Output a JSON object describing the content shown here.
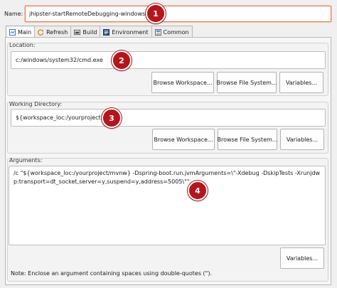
{
  "name": {
    "label": "Name:",
    "value": "jhipster-startRemoteDebugging-windows"
  },
  "tabs": [
    {
      "label": "Main",
      "icon": "main-tab-icon",
      "active": true
    },
    {
      "label": "Refresh",
      "icon": "refresh-icon",
      "active": false
    },
    {
      "label": "Build",
      "icon": "build-icon",
      "active": false
    },
    {
      "label": "Environment",
      "icon": "environment-icon",
      "active": false
    },
    {
      "label": "Common",
      "icon": "common-icon",
      "active": false
    }
  ],
  "location": {
    "label": "Location:",
    "value": "c:/windows/system32/cmd.exe",
    "browse_workspace": "Browse Workspace...",
    "browse_file_system": "Browse File System...",
    "variables": "Variables..."
  },
  "working_directory": {
    "label": "Working Directory:",
    "value": "${workspace_loc:/yourproject}",
    "browse_workspace": "Browse Workspace...",
    "browse_file_system": "Browse File System...",
    "variables": "Variables..."
  },
  "arguments": {
    "label": "Arguments:",
    "value": "/c \"${workspace_loc:/yourproject/mvnw} -Dspring-boot.run.jvmArguments=\\\"-Xdebug -DskipTests -Xrunjdwp:transport=dt_socket,server=y,suspend=y,address=5005\\\"\"",
    "variables": "Variables...",
    "note": "Note: Enclose an argument containing spaces using double-quotes (\")."
  },
  "callouts": [
    "1",
    "2",
    "3",
    "4"
  ],
  "colors": {
    "callout": "#b4161c",
    "name_field_border": "#e87a55"
  }
}
